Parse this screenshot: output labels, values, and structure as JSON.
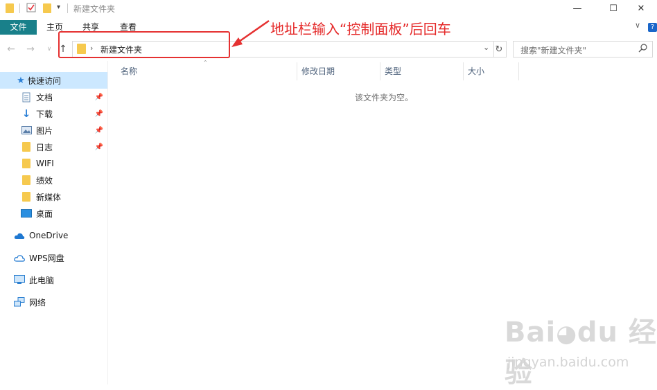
{
  "window": {
    "title": "新建文件夹"
  },
  "ribbon": {
    "tabs": [
      "文件",
      "主页",
      "共享",
      "查看"
    ]
  },
  "address": {
    "path": "新建文件夹"
  },
  "search": {
    "placeholder": "搜索\"新建文件夹\""
  },
  "annotation": {
    "text": "地址栏输入“控制面板”后回车",
    "color": "#e52a2a"
  },
  "sidebar": {
    "quick_access": "快速访问",
    "pinned": [
      {
        "label": "文档",
        "icon": "document-icon"
      },
      {
        "label": "下载",
        "icon": "download-icon"
      },
      {
        "label": "图片",
        "icon": "pictures-icon"
      },
      {
        "label": "日志",
        "icon": "folder-icon"
      }
    ],
    "folders": [
      {
        "label": "WIFI",
        "icon": "folder-icon"
      },
      {
        "label": "绩效",
        "icon": "folder-icon"
      },
      {
        "label": "新媒体",
        "icon": "folder-icon"
      },
      {
        "label": "桌面",
        "icon": "desktop-icon"
      }
    ],
    "locations": [
      {
        "label": "OneDrive",
        "icon": "cloud-icon"
      },
      {
        "label": "WPS网盘",
        "icon": "cloud-outline-icon"
      },
      {
        "label": "此电脑",
        "icon": "computer-icon"
      },
      {
        "label": "网络",
        "icon": "network-icon"
      }
    ]
  },
  "columns": {
    "name": "名称",
    "modified": "修改日期",
    "type": "类型",
    "size": "大小"
  },
  "content": {
    "empty_message": "该文件夹为空。"
  },
  "watermark": {
    "logo": "Bai 经验",
    "url": "jingyan.baidu.com"
  }
}
